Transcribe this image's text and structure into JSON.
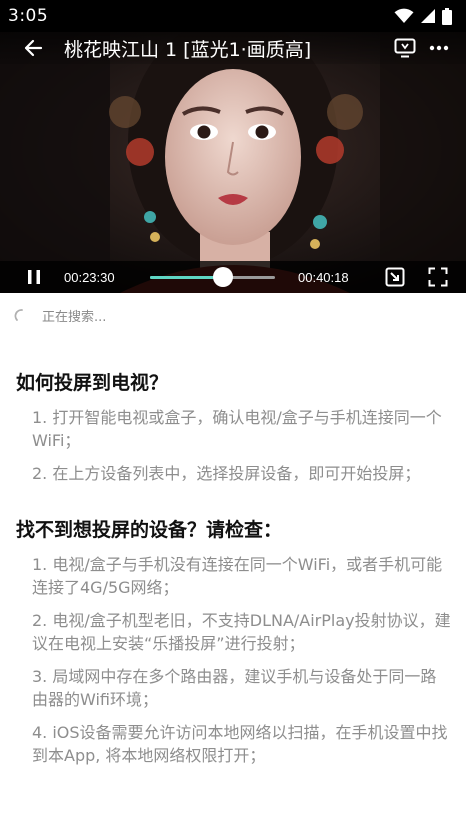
{
  "status_bar": {
    "time": "3:05"
  },
  "player": {
    "title": "桃花映江山 1 [蓝光1·画质高]",
    "current_time": "00:23:30",
    "total_time": "00:40:18",
    "progress": 0.583
  },
  "search": {
    "status": "正在搜索..."
  },
  "help": {
    "section1": {
      "title": "如何投屏到电视？",
      "tips": [
        "1. 打开智能电视或盒子，确认电视/盒子与手机连接同一个WiFi；",
        "2. 在上方设备列表中，选择投屏设备，即可开始投屏；"
      ]
    },
    "section2": {
      "title": "找不到想投屏的设备？请检查：",
      "tips": [
        "1. 电视/盒子与手机没有连接在同一个WiFi，或者手机可能连接了4G/5G网络；",
        "2. 电视/盒子机型老旧，不支持DLNA/AirPlay投射协议，建议在电视上安装“乐播投屏”进行投射；",
        "3. 局域网中存在多个路由器，建议手机与设备处于同一路由器的Wifi环境；",
        "4. iOS设备需要允许访问本地网络以扫描，在手机设置中找到本App, 将本地网络权限打开；"
      ]
    }
  }
}
